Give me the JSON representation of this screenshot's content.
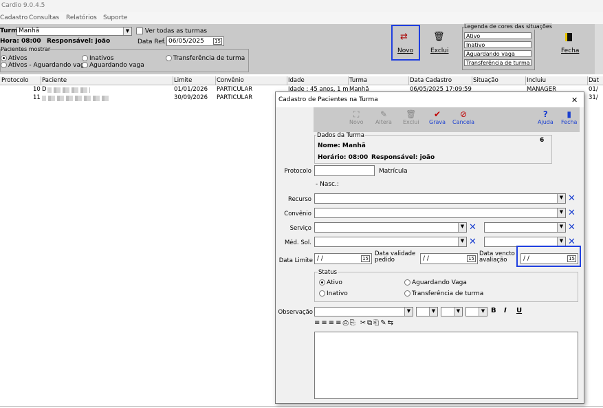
{
  "app": {
    "title": "Cardio 9.0.4.5"
  },
  "menu": [
    "Cadastro",
    "Consultas",
    "Relatórios",
    "Suporte"
  ],
  "filters": {
    "turma_label": "Turma",
    "turma_value": "Manhã",
    "ver_todas_label": "Ver todas as turmas",
    "hora_label": "Hora: 08:00",
    "responsavel_label": "Responsável: joão",
    "data_ref_label": "Data Ref.",
    "data_ref_value": "06/05/2025",
    "pacientes_group": "Pacientes mostrar",
    "radios": [
      "Ativos",
      "Inativos",
      "Transferência de turma",
      "Ativos - Aguardando vaga",
      "Aguardando vaga"
    ]
  },
  "toolbar": {
    "novo": "Novo",
    "exclui": "Exclui",
    "fecha": "Fecha"
  },
  "legend": {
    "title": "Legenda de cores das situações",
    "items": [
      "Ativo",
      "Inativo",
      "Aguardando vaga",
      "Transferência de turma"
    ]
  },
  "grid": {
    "columns": [
      "Protocolo",
      "Paciente",
      "Limite",
      "Convênio",
      "Idade",
      "Turma",
      "Data Cadastro",
      "Situação",
      "Incluiu",
      "Dat"
    ],
    "rows": [
      {
        "protocolo": "10",
        "paciente": "D",
        "limite": "01/01/2026",
        "convenio": "PARTICULAR",
        "idade": "Idade : 45 anos, 1 m",
        "turma": "Manhã",
        "cadastro": "06/05/2025 17:09:59",
        "incluiu": "MANAGER",
        "dat": "01/"
      },
      {
        "protocolo": "11",
        "paciente": "",
        "limite": "30/09/2026",
        "convenio": "PARTICULAR",
        "idade": "",
        "turma": "",
        "cadastro": "",
        "incluiu": "",
        "dat": "31/"
      }
    ]
  },
  "dialog": {
    "title": "Cadastro de Pacientes na Turma",
    "close": "✕",
    "buttons": {
      "novo": "Novo",
      "altera": "Altera",
      "exclui": "Exclui",
      "grava": "Grava",
      "cancela": "Cancela",
      "ajuda": "Ajuda",
      "fecha": "Fecha"
    },
    "dados_turma": {
      "title": "Dados da Turma",
      "nome": "Nome: Manhã",
      "horario": "Horário: 08:00",
      "responsavel": "Responsável: joão",
      "count": "6"
    },
    "labels": {
      "protocolo": "Protocolo",
      "matricula": "Matrícula",
      "nasc": "- Nasc.:",
      "recurso": "Recurso",
      "convenio": "Convênio",
      "servico": "Serviço",
      "med_sol": "Méd. Sol.",
      "data_limite": "Data Limite",
      "data_validade": "Data validade pedido",
      "data_vencto": "Data vencto avaliação",
      "observacao": "Observação"
    },
    "dates": {
      "limite": "/ /",
      "validade": "/ /",
      "vencto": "/ /"
    },
    "status": {
      "title": "Status",
      "ativo": "Ativo",
      "inativo": "Inativo",
      "aguardando": "Aguardando Vaga",
      "transferencia": "Transferência de turma"
    },
    "format": {
      "bold": "B",
      "italic": "I",
      "underline": "U"
    }
  },
  "colors": {
    "highlight": "#1f3fe0",
    "toolbar": "#c9c9c9",
    "xbutton": "#1a3fd0",
    "grava": "#c00000"
  }
}
